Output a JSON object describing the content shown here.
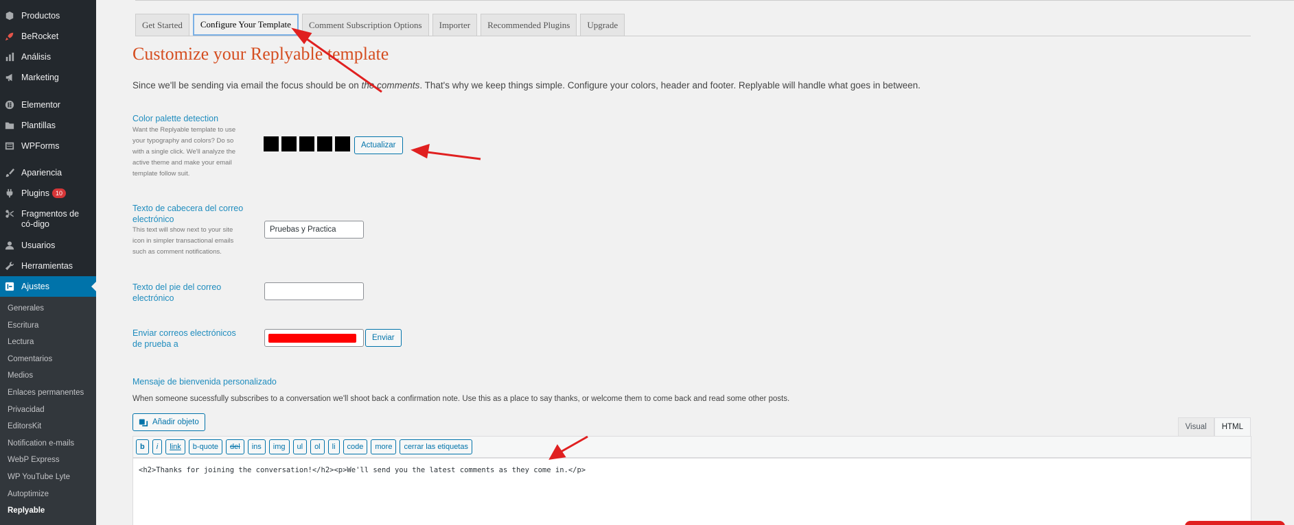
{
  "sidebar": {
    "items": [
      {
        "label": "Productos",
        "icon": "products-icon"
      },
      {
        "label": "BeRocket",
        "icon": "rocket-icon"
      },
      {
        "label": "Análisis",
        "icon": "analytics-icon"
      },
      {
        "label": "Marketing",
        "icon": "megaphone-icon"
      },
      {
        "label": "Elementor",
        "icon": "elementor-icon"
      },
      {
        "label": "Plantillas",
        "icon": "folder-icon"
      },
      {
        "label": "WPForms",
        "icon": "forms-icon"
      },
      {
        "label": "Apariencia",
        "icon": "paintbrush-icon"
      },
      {
        "label": "Plugins",
        "icon": "plugin-icon",
        "badge": "10"
      },
      {
        "label": "Fragmentos de có-digo",
        "icon": "scissors-icon"
      },
      {
        "label": "Usuarios",
        "icon": "user-icon"
      },
      {
        "label": "Herramientas",
        "icon": "wrench-icon"
      },
      {
        "label": "Ajustes",
        "icon": "settings-icon"
      }
    ],
    "submenu": [
      "Generales",
      "Escritura",
      "Lectura",
      "Comentarios",
      "Medios",
      "Enlaces permanentes",
      "Privacidad",
      "EditorsKit",
      "Notification e-mails",
      "WebP Express",
      "WP YouTube Lyte",
      "Autoptimize",
      "Replyable"
    ]
  },
  "tabs": [
    "Get Started",
    "Configure Your Template",
    "Comment Subscription Options",
    "Importer",
    "Recommended Plugins",
    "Upgrade"
  ],
  "page": {
    "title": "Customize your Replyable template",
    "intro_before": "Since we'll be sending via email the focus should be on ",
    "intro_em": "the comments",
    "intro_after": ". That's why we keep things simple. Configure your colors, header and footer. Replyable will handle what goes in between."
  },
  "palette": {
    "label": "Color palette detection",
    "desc": "Want the Replyable template to use your typography and colors? Do so with a single click. We'll analyze the active theme and make your email template follow suit.",
    "button": "Actualizar",
    "swatch_color": "#000000"
  },
  "header_field": {
    "label": "Texto de cabecera del correo electrónico",
    "desc": "This text will show next to your site icon in simpler transactional emails such as comment notifications.",
    "value": "Pruebas y Practica"
  },
  "footer_field": {
    "label": "Texto del pie del correo electrónico",
    "value": ""
  },
  "test_email": {
    "label": "Enviar correos electrónicos de prueba a",
    "button": "Enviar"
  },
  "welcome": {
    "label": "Mensaje de bienvenida personalizado",
    "desc": "When someone sucessfully subscribes to a conversation we'll shoot back a confirmation note. Use this as a place to say thanks, or welcome them to come back and read some other posts.",
    "add_media": "Añadir objeto",
    "editor_tabs": [
      "Visual",
      "HTML"
    ],
    "quicktags": [
      "b",
      "i",
      "link",
      "b-quote",
      "del",
      "ins",
      "img",
      "ul",
      "ol",
      "li",
      "code",
      "more",
      "cerrar las etiquetas"
    ],
    "content": "<h2>Thanks for joining the conversation!</h2><p>We'll send you the latest comments as they come in.</p>"
  },
  "colors": {
    "accent": "#0073aa",
    "title": "#d54e21",
    "annotation": "#e02020",
    "sidebar": "#23282d"
  }
}
